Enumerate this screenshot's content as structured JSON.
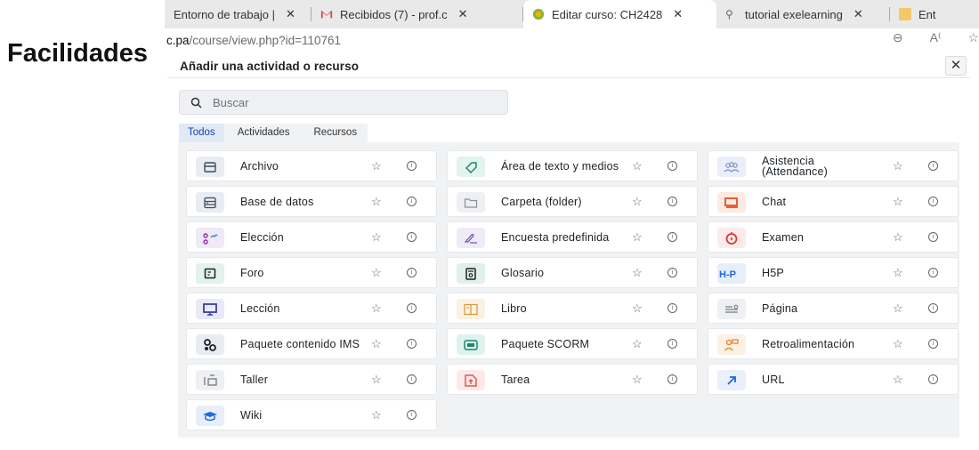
{
  "side_title": "Facilidades",
  "browser": {
    "tabs": [
      {
        "title": "Entorno de trabajo |",
        "active": false
      },
      {
        "title": "Recibidos (7) - prof.c",
        "active": false
      },
      {
        "title": "Editar curso: CH2428",
        "active": true
      },
      {
        "title": "tutorial exelearning",
        "active": false
      },
      {
        "title": "Ent",
        "active": false
      }
    ],
    "address_host": "c.pa",
    "address_path": "/course/view.php?id=110761"
  },
  "modal": {
    "title": "Añadir una actividad o recurso",
    "close_label": "✕",
    "search": {
      "placeholder": "Buscar"
    },
    "tabs": [
      {
        "label": "Todos",
        "active": true
      },
      {
        "label": "Actividades",
        "active": false
      },
      {
        "label": "Recursos",
        "active": false
      }
    ],
    "items": [
      {
        "label": "Archivo",
        "icon": "file-icon",
        "color": "#e9ecf3"
      },
      {
        "label": "Área de texto y medios",
        "icon": "label-tag-icon",
        "color": "#e3f3ee"
      },
      {
        "label": "Asistencia (Attendance)",
        "icon": "people-icon",
        "color": "#eaeef8"
      },
      {
        "label": "Base de datos",
        "icon": "database-icon",
        "color": "#eaecf3"
      },
      {
        "label": "Carpeta (folder)",
        "icon": "folder-icon",
        "color": "#eef0f3"
      },
      {
        "label": "Chat",
        "icon": "chat-icon",
        "color": "#fdebe1"
      },
      {
        "label": "Elección",
        "icon": "choice-icon",
        "color": "#f0e9f7"
      },
      {
        "label": "Encuesta predefinida",
        "icon": "survey-icon",
        "color": "#f0ebf8"
      },
      {
        "label": "Examen",
        "icon": "quiz-icon",
        "color": "#fdeaea"
      },
      {
        "label": "Foro",
        "icon": "forum-icon",
        "color": "#e2f2ec"
      },
      {
        "label": "Glosario",
        "icon": "glossary-icon",
        "color": "#e2f0ec"
      },
      {
        "label": "H5P",
        "icon": "h5p-icon",
        "color": "#e6eef9"
      },
      {
        "label": "Lección",
        "icon": "lesson-icon",
        "color": "#e8eaf6"
      },
      {
        "label": "Libro",
        "icon": "book-icon",
        "color": "#fbf1e2"
      },
      {
        "label": "Página",
        "icon": "page-icon",
        "color": "#eef0f3"
      },
      {
        "label": "Paquete contenido IMS",
        "icon": "ims-package-icon",
        "color": "#e9ecf3"
      },
      {
        "label": "Paquete SCORM",
        "icon": "scorm-icon",
        "color": "#dff3ee"
      },
      {
        "label": "Retroalimentación",
        "icon": "feedback-icon",
        "color": "#fdf1e3"
      },
      {
        "label": "Taller",
        "icon": "workshop-icon",
        "color": "#eef0f3"
      },
      {
        "label": "Tarea",
        "icon": "assignment-icon",
        "color": "#fde8ea"
      },
      {
        "label": "URL",
        "icon": "url-arrow-icon",
        "color": "#eaf0fa"
      },
      {
        "label": "Wiki",
        "icon": "wiki-icon",
        "color": "#e6eefa"
      }
    ]
  }
}
